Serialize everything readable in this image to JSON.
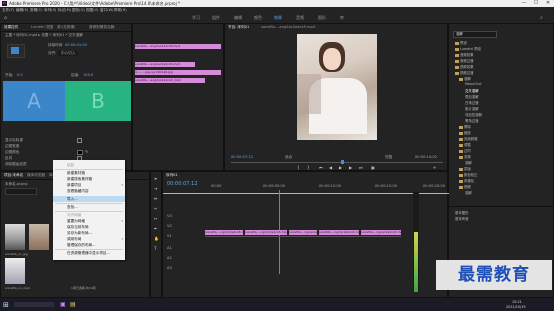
{
  "window": {
    "title": "Adobe Premiere Pro 2020 - C:\\用户\\Video\\文件\\Adobe\\Premiere Pro\\14.0\\未命名.prproj *",
    "min": "—",
    "max": "☐",
    "close": "✕"
  },
  "menubar": [
    "文件(F)",
    "编辑(E)",
    "剪辑(C)",
    "序列(S)",
    "标记(M)",
    "图形(G)",
    "视图(V)",
    "窗口(W)",
    "帮助(H)"
  ],
  "workspaces": [
    "学习",
    "组件",
    "编辑",
    "颜色",
    "效果",
    "音频",
    "图形",
    "库"
  ],
  "workspace_active": "效果",
  "effect_controls": {
    "tabs": [
      "效果控件",
      "Lumetri 范围",
      "源:(无剪辑)",
      "音频剪辑混合器:"
    ],
    "source_row": "主要 * 序列01.mp4  ▸  总要 * 序列01 * 交叉溶解",
    "duration_label": "持续时间",
    "duration": "00:00:01:00",
    "align_label": "对齐:",
    "align_value": "中心切入",
    "a_label": "A",
    "b_label": "B",
    "start_label": "开始:",
    "start_value": "0.0",
    "end_label": "结束:",
    "end_value": "100.0",
    "show_actual": "显示实际源",
    "border_width": "边框宽度",
    "border_color": "边框颜色",
    "reverse": "反向",
    "antialias": "消除锯齿品质",
    "antialias_value": "关"
  },
  "mini_timeline": {
    "clip1": "sonaMa....ang2ac2a4ca5.mp4",
    "clip2": "sonaMa....ang2ac2a4ca5.mp4",
    "clip3": "lo........jpg,ng 12b0q6.jpg",
    "clip4": "sonaMa....ang2ac2a4ca5_mp4"
  },
  "program": {
    "tab": "节目: 序列01",
    "tab2": "sonaMa....ang2ac2a4ca5.mp4",
    "timecode": "00:00:07:12",
    "fit": "适合",
    "quality": "完整",
    "duration": "00:00:14:02"
  },
  "project": {
    "tabs": [
      "项目:未命名",
      "媒体浏览器",
      "库",
      "信息",
      "效果",
      "标记",
      "历史记录"
    ],
    "file": "未命名.prproj",
    "item_count": "1项已选择,共10项",
    "thumb_label1": "sonaMa_sn_jpg",
    "thumb_label2": "sonaMa_sn_mp4"
  },
  "context_menu": {
    "items": [
      {
        "label": "粘贴",
        "disabled": true
      },
      {
        "label": "新建素材箱",
        "disabled": false
      },
      {
        "label": "新建搜索素材箱",
        "disabled": false
      },
      {
        "label": "新建项目",
        "disabled": false,
        "arrow": true
      },
      {
        "label": "查看隐藏内容",
        "disabled": false
      },
      {
        "label": "导入...",
        "disabled": false,
        "highlight": true
      },
      {
        "label": "查找...",
        "disabled": false
      },
      {
        "label": "对齐网格",
        "disabled": true
      },
      {
        "label": "重置为网格",
        "disabled": false,
        "arrow": true
      },
      {
        "label": "保存当前布局",
        "disabled": false
      },
      {
        "label": "另存为新布局...",
        "disabled": false
      },
      {
        "label": "调用布局",
        "disabled": false,
        "arrow": true
      },
      {
        "label": "管理保存的布局...",
        "disabled": false
      },
      {
        "label": "在资源管理器中显示项目...",
        "disabled": false
      }
    ]
  },
  "timeline": {
    "tab": "序列01",
    "timecode": "00:00:07:12",
    "tracks": [
      "V3",
      "V2",
      "V1",
      "A1",
      "A2",
      "A3"
    ],
    "clips": [
      {
        "label": "sonaMa....ng2ac2a4ca5.mp4"
      },
      {
        "label": "sonaMa....ng2ac2a4ca5.mp4"
      },
      {
        "label": "sonaMa....ng2ac2a4ca5.mp4"
      },
      {
        "label": "sonaMa....ng2ac2a4ca5.mp4"
      },
      {
        "label": "sonaMa....ng2ac2a4ca5.mp4"
      }
    ],
    "ruler": [
      "00:00",
      "00:00:05:00",
      "00:00:10:00",
      "00:00:15:00",
      "00:00:20:00"
    ]
  },
  "effects": {
    "search": "溶解",
    "items": [
      "预设",
      "Lumetri 预设",
      "音频效果",
      "音频过渡",
      "视频效果",
      "视频过渡",
      "溶解",
      "MorphCut",
      "交叉溶解",
      "叠加溶解",
      "白场过渡",
      "胶片溶解",
      "非加性溶解",
      "黑场过渡",
      "擦除",
      "缩放",
      "页面剥落",
      "调整",
      "过时",
      "变换",
      "溶解",
      "蒙版",
      "颜色校正",
      "风格化",
      "视频",
      "溶解"
    ],
    "bottom": [
      "基本图形",
      "基本声音"
    ]
  },
  "taskbar": {
    "time": "15:21",
    "date": "2021/10/19"
  },
  "watermark": "最需教育",
  "colors": {
    "accent": "#5ea6f3",
    "clip": "#d48cd9",
    "a_box": "#3a86c8",
    "b_box": "#28b482",
    "playhead": "#3b8ef0"
  }
}
